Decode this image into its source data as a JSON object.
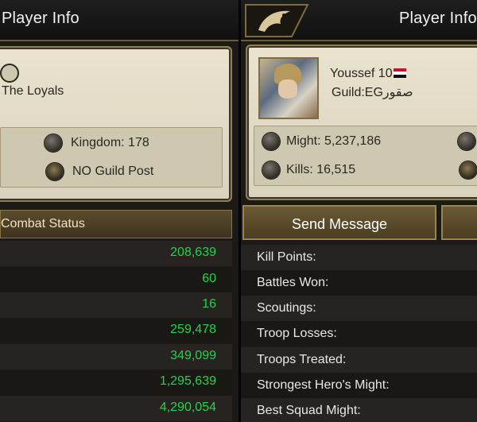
{
  "left_panel": {
    "title": "Player Info",
    "guild_name": "The Loyals",
    "kingdom": "Kingdom: 178",
    "guild_post": "NO Guild Post",
    "combat_status_label": "Combat Status",
    "combat_values": [
      "208,639",
      "60",
      "16",
      "259,478",
      "349,099",
      "1,295,639",
      "4,290,054"
    ]
  },
  "right_panel": {
    "title": "Player Info",
    "player_name": "Youssef 10",
    "guild": "Guild:EGصقور",
    "might": "Might: 5,237,186",
    "kills": "Kills: 16,515",
    "send_message_label": "Send Message",
    "stat_labels": [
      "Kill Points:",
      "Battles Won:",
      "Scoutings:",
      "Troop Losses:",
      "Troops Treated:",
      "Strongest Hero's Might:",
      "Best Squad Might:"
    ]
  },
  "colors": {
    "accent_gold": "#8b7442",
    "value_green": "#23d44a"
  }
}
